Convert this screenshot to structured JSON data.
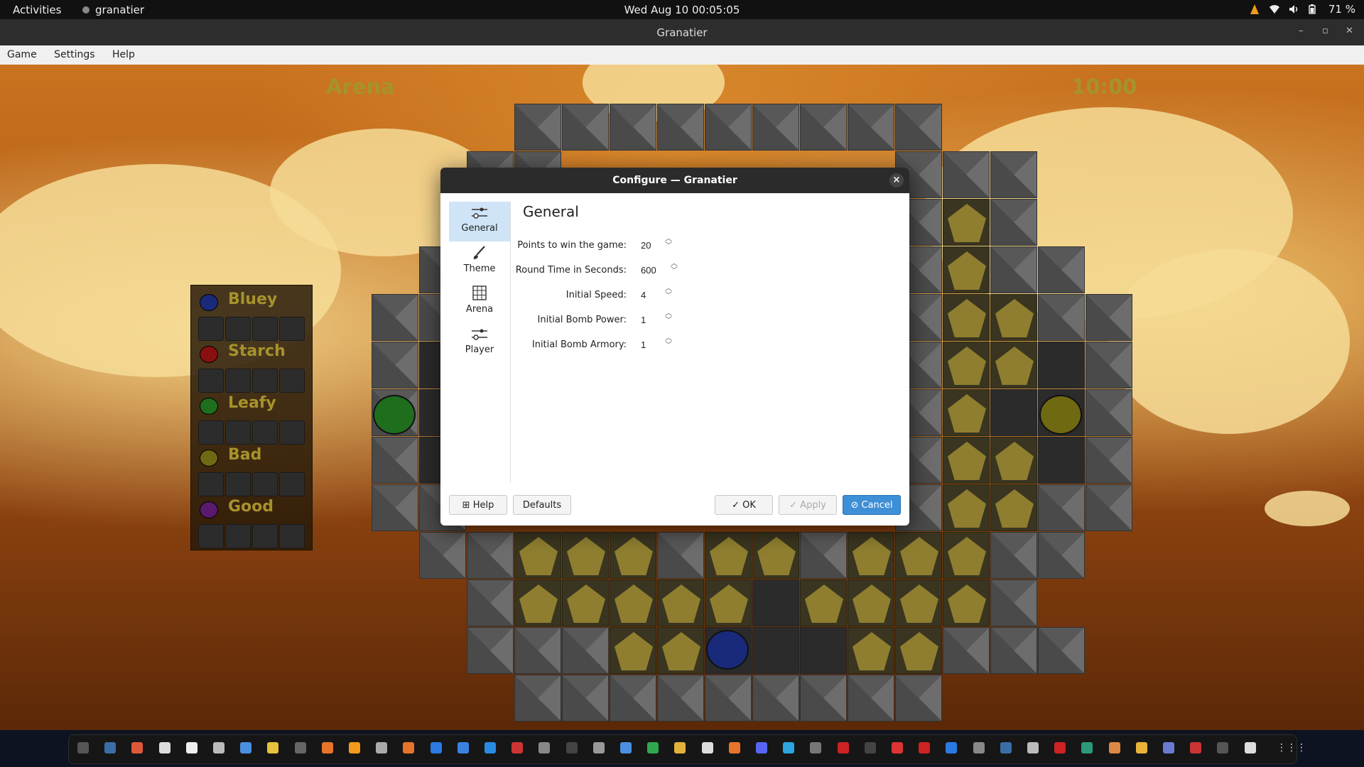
{
  "topbar": {
    "activities": "Activities",
    "app_name": "granatier",
    "clock": "Wed Aug 10  00:05:05",
    "battery": "71 %"
  },
  "window": {
    "title": "Granatier",
    "controls": [
      "–",
      "▫",
      "✕"
    ]
  },
  "menubar": [
    "Game",
    "Settings",
    "Help"
  ],
  "game": {
    "arena_name": "Arena",
    "time": "10:00",
    "players": [
      {
        "name": "Bluey",
        "color": "#1a2a7a"
      },
      {
        "name": "Starch",
        "color": "#8a1010"
      },
      {
        "name": "Leafy",
        "color": "#1e6e1e"
      },
      {
        "name": "Bad",
        "color": "#6f6a12"
      },
      {
        "name": "Good",
        "color": "#5a1a6e"
      }
    ]
  },
  "dialog": {
    "title": "Configure — Granatier",
    "close": "×",
    "sidebar": [
      {
        "label": "General",
        "icon": "sliders-icon",
        "glyph": "⊸"
      },
      {
        "label": "Theme",
        "icon": "brush-icon",
        "glyph": "✎"
      },
      {
        "label": "Arena",
        "icon": "grid-icon",
        "glyph": "▦"
      },
      {
        "label": "Player",
        "icon": "sliders-icon",
        "glyph": "⊸"
      }
    ],
    "section_title": "General",
    "fields": [
      {
        "label": "Points to win the game:",
        "value": "20"
      },
      {
        "label": "Round Time in Seconds:",
        "value": "600"
      },
      {
        "label": "Initial Speed:",
        "value": "4"
      },
      {
        "label": "Initial Bomb Power:",
        "value": "1"
      },
      {
        "label": "Initial Bomb Armory:",
        "value": "1"
      }
    ],
    "buttons": {
      "help": "Help",
      "defaults": "Defaults",
      "ok": "OK",
      "apply": "Apply",
      "cancel": "Cancel"
    }
  }
}
